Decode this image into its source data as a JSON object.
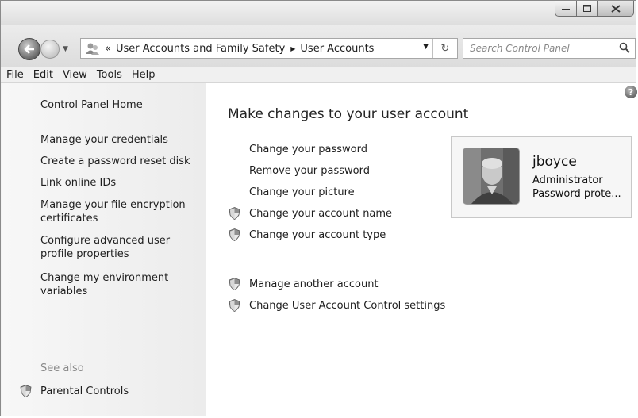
{
  "window": {
    "caption_buttons": [
      "minimize",
      "maximize",
      "close"
    ]
  },
  "address_bar": {
    "overflow_glyph": "«",
    "breadcrumb": [
      "User Accounts and Family Safety",
      "User Accounts"
    ],
    "refresh_glyph": "↻"
  },
  "search": {
    "placeholder": "Search Control Panel"
  },
  "menu": [
    "File",
    "Edit",
    "View",
    "Tools",
    "Help"
  ],
  "sidebar": {
    "home": "Control Panel Home",
    "links": [
      "Manage your credentials",
      "Create a password reset disk",
      "Link online IDs",
      "Manage your file encryption certificates",
      "Configure advanced user profile properties",
      "Change my environment variables"
    ],
    "see_also_label": "See also",
    "see_also_links": [
      "Parental Controls"
    ]
  },
  "main": {
    "help_glyph": "?",
    "heading": "Make changes to your user account",
    "tasks": [
      "Change your password",
      "Remove your password",
      "Change your picture",
      "Change your account name",
      "Change your account type"
    ],
    "other_tasks": [
      "Manage another account",
      "Change User Account Control settings"
    ]
  },
  "user": {
    "name": "jboyce",
    "role": "Administrator",
    "status": "Password prote..."
  }
}
